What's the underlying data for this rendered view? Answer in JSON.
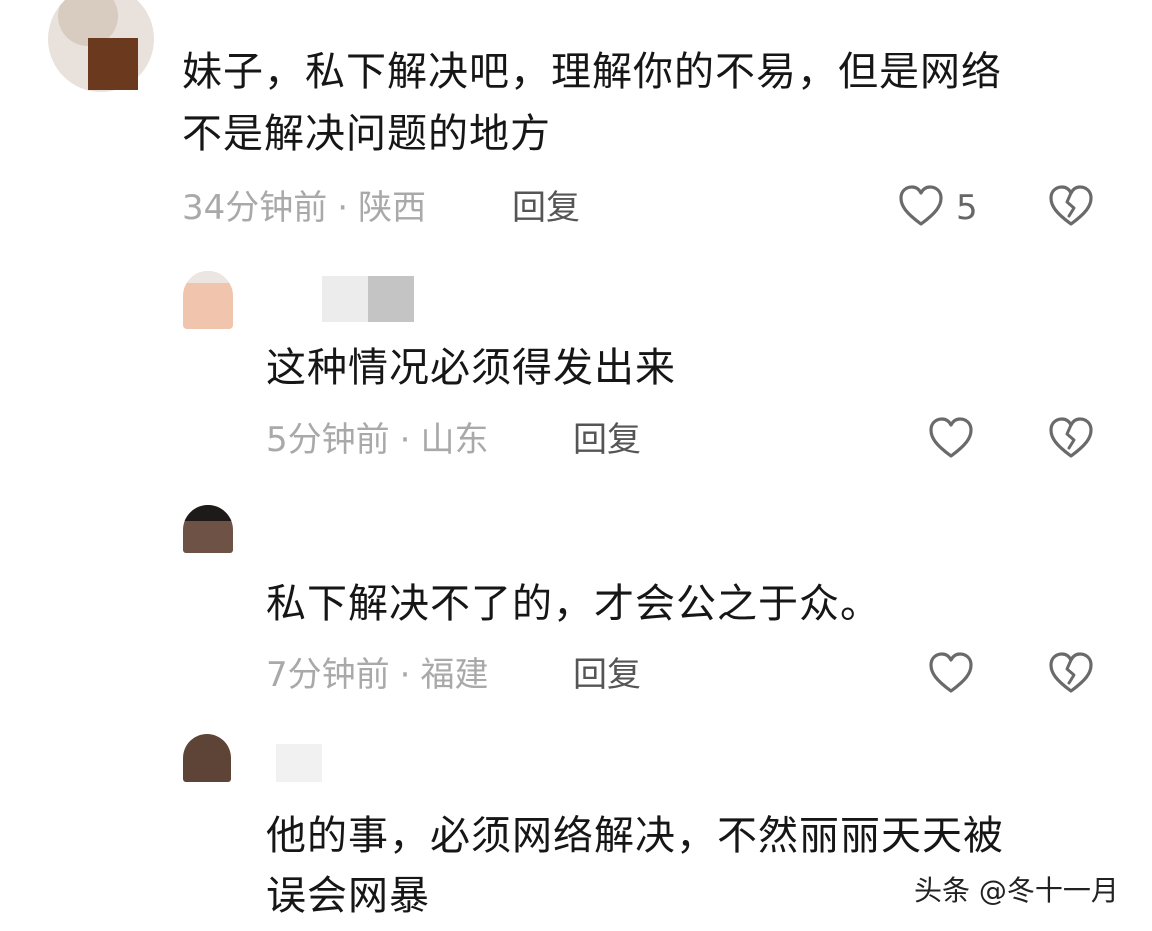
{
  "comments": [
    {
      "text_lines": [
        "妹子，私下解决吧，理解你的不易，但是网络",
        "不是解决问题的地方"
      ],
      "time": "34分钟前",
      "location": "陕西",
      "reply_label": "回复",
      "like_count": "5"
    },
    {
      "text_lines": [
        "这种情况必须得发出来"
      ],
      "time": "5分钟前",
      "location": "山东",
      "reply_label": "回复"
    },
    {
      "text_lines": [
        "私下解决不了的，才会公之于众。"
      ],
      "time": "7分钟前",
      "location": "福建",
      "reply_label": "回复"
    },
    {
      "text_lines": [
        "他的事，必须网络解决，不然丽丽天天被",
        "误会网暴"
      ]
    }
  ],
  "separator": "·",
  "watermark": "头条 @冬十一月",
  "colors": {
    "text": "#161616",
    "meta": "#a9a9a9",
    "reply": "#555555",
    "icon": "#6a6a6a"
  }
}
